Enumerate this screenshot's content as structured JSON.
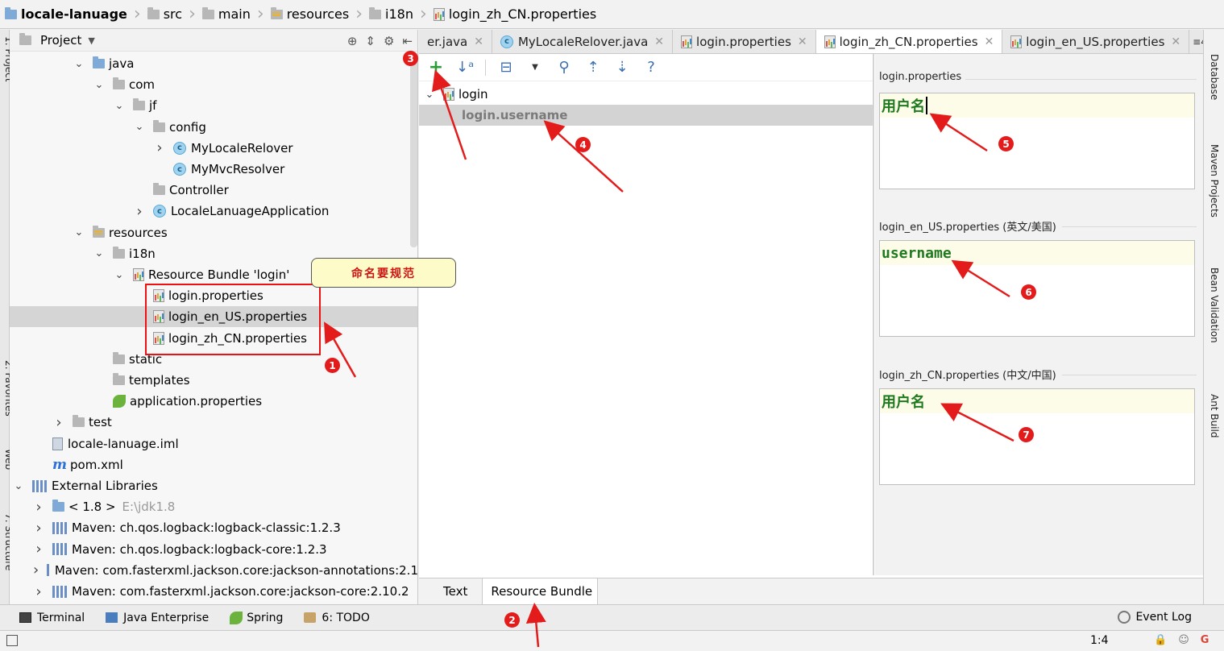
{
  "breadcrumb": [
    "locale-lanuage",
    "src",
    "main",
    "resources",
    "i18n",
    "login_zh_CN.properties"
  ],
  "project_panel": {
    "title": "Project",
    "tree": [
      {
        "label": "java",
        "indent": 3,
        "icon": "folder-blue-icon",
        "chevron": "down"
      },
      {
        "label": "com",
        "indent": 4,
        "icon": "folder-icon",
        "chevron": "down"
      },
      {
        "label": "jf",
        "indent": 5,
        "icon": "folder-icon",
        "chevron": "down"
      },
      {
        "label": "config",
        "indent": 6,
        "icon": "folder-icon",
        "chevron": "down"
      },
      {
        "label": "MyLocaleRelover",
        "indent": 7,
        "icon": "class-icon",
        "chevron": "right"
      },
      {
        "label": "MyMvcResolver",
        "indent": 7,
        "icon": "class-icon",
        "chevron": ""
      },
      {
        "label": "Controller",
        "indent": 6,
        "icon": "folder-icon",
        "chevron": ""
      },
      {
        "label": "LocaleLanuageApplication",
        "indent": 6,
        "icon": "spring-class-icon",
        "chevron": "right"
      },
      {
        "label": "resources",
        "indent": 3,
        "icon": "resources-folder-icon",
        "chevron": "down"
      },
      {
        "label": "i18n",
        "indent": 4,
        "icon": "folder-icon",
        "chevron": "down"
      },
      {
        "label": "Resource Bundle 'login'",
        "indent": 5,
        "icon": "resource-bundle-icon",
        "chevron": "down"
      },
      {
        "label": "login.properties",
        "indent": 6,
        "icon": "properties-icon",
        "chevron": ""
      },
      {
        "label": "login_en_US.properties",
        "indent": 6,
        "icon": "properties-icon",
        "chevron": "",
        "selected": true
      },
      {
        "label": "login_zh_CN.properties",
        "indent": 6,
        "icon": "properties-icon",
        "chevron": ""
      },
      {
        "label": "static",
        "indent": 4,
        "icon": "folder-icon",
        "chevron": ""
      },
      {
        "label": "templates",
        "indent": 4,
        "icon": "folder-icon",
        "chevron": ""
      },
      {
        "label": "application.properties",
        "indent": 4,
        "icon": "spring-icon",
        "chevron": ""
      },
      {
        "label": "test",
        "indent": 2,
        "icon": "folder-icon",
        "chevron": "right"
      },
      {
        "label": "locale-lanuage.iml",
        "indent": 1,
        "icon": "file-icon",
        "chevron": ""
      },
      {
        "label": "pom.xml",
        "indent": 1,
        "icon": "maven-icon",
        "chevron": ""
      },
      {
        "label": "External Libraries",
        "indent": 0,
        "icon": "library-icon",
        "chevron": "down"
      },
      {
        "label": "< 1.8 >",
        "extra": "E:\\jdk1.8",
        "indent": 1,
        "icon": "jdk-icon",
        "chevron": "right"
      },
      {
        "label": "Maven: ch.qos.logback:logback-classic:1.2.3",
        "indent": 1,
        "icon": "library-icon",
        "chevron": "right"
      },
      {
        "label": "Maven: ch.qos.logback:logback-core:1.2.3",
        "indent": 1,
        "icon": "library-icon",
        "chevron": "right"
      },
      {
        "label": "Maven: com.fasterxml.jackson.core:jackson-annotations:2.1",
        "indent": 1,
        "icon": "library-icon",
        "chevron": "right"
      },
      {
        "label": "Maven: com.fasterxml.jackson.core:jackson-core:2.10.2",
        "indent": 1,
        "icon": "library-icon",
        "chevron": "right"
      }
    ]
  },
  "editor_tabs": [
    {
      "label": "er.java",
      "icon": "",
      "active": false
    },
    {
      "label": "MyLocaleRelover.java",
      "icon": "class-icon",
      "active": false
    },
    {
      "label": "login.properties",
      "icon": "properties-icon",
      "active": false
    },
    {
      "label": "login_zh_CN.properties",
      "icon": "properties-icon",
      "active": true
    },
    {
      "label": "login_en_US.properties",
      "icon": "properties-icon",
      "active": false
    }
  ],
  "tabs_overflow": "4",
  "rb_editor": {
    "keys": [
      {
        "label": "login",
        "group": true
      },
      {
        "label": "login.username",
        "selected": true
      }
    ],
    "values": [
      {
        "label": "login.properties",
        "value": "用户名",
        "caret": true
      },
      {
        "label": "login_en_US.properties (英文/美国)",
        "value": "username"
      },
      {
        "label": "login_zh_CN.properties (中文/中国)",
        "value": "用户名"
      }
    ]
  },
  "bottom_tabs": [
    "Text",
    "Resource Bundle"
  ],
  "tool_windows": [
    "Terminal",
    "Java Enterprise",
    "Spring",
    "6: TODO"
  ],
  "event_log": "Event Log",
  "right_strip": [
    "Database",
    "Maven Projects",
    "Bean Validation",
    "Ant Build"
  ],
  "left_strip": [
    "1: Project",
    "2: Favorites",
    "Web",
    "7: Structure"
  ],
  "status": {
    "position": "1:4"
  },
  "annotations": {
    "callout": "命名要规范",
    "badges": [
      "1",
      "2",
      "3",
      "4",
      "5",
      "6",
      "7"
    ]
  },
  "colors": {
    "annotation": "#e41b1b",
    "value_text": "#1f7a1f",
    "callout_bg": "#fdfcc8"
  }
}
